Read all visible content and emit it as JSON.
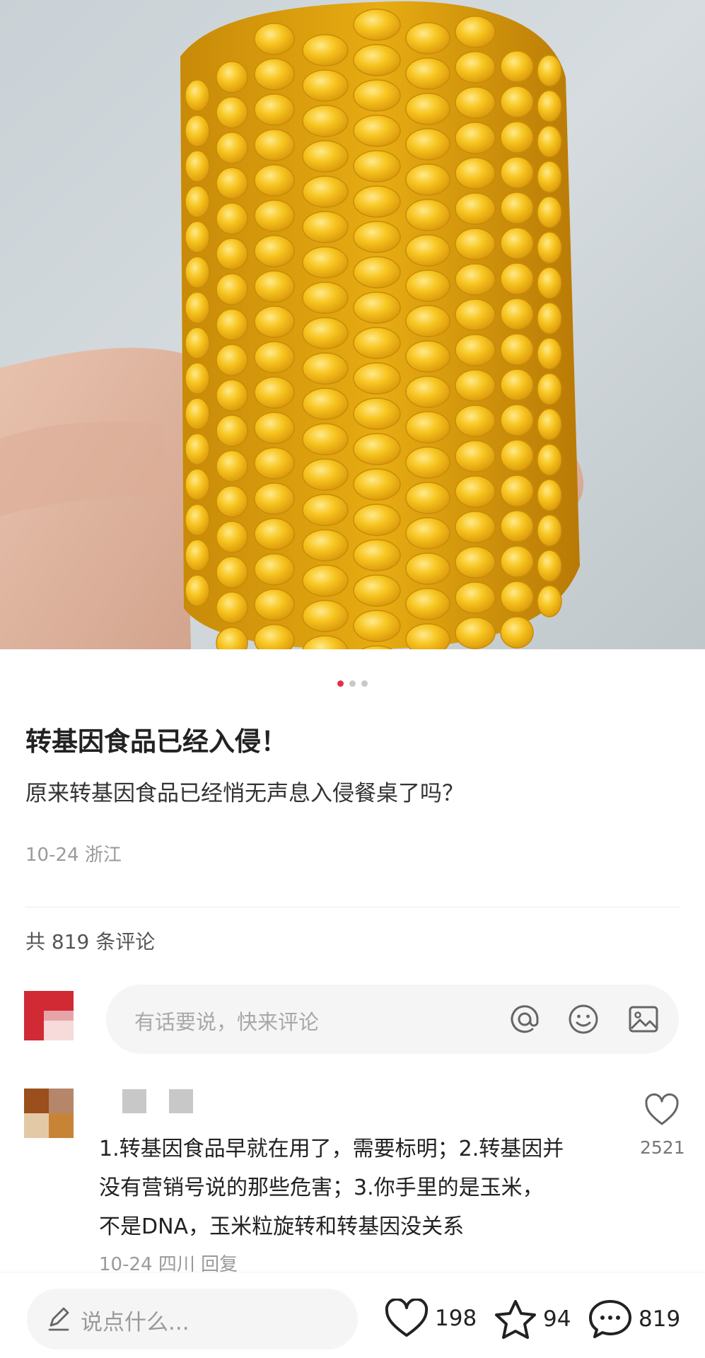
{
  "post": {
    "title": "转基因食品已经入侵！",
    "body": "原来转基因食品已经悄无声息入侵餐桌了吗？",
    "date": "10-24",
    "location": "浙江",
    "carousel": {
      "total": 3,
      "active": 1
    }
  },
  "comments_header": {
    "count_text": "共 819 条评论"
  },
  "comment_input": {
    "placeholder": "有话要说，快来评论",
    "icons": [
      "at-icon",
      "emoji-icon",
      "image-icon"
    ]
  },
  "comments": [
    {
      "text_lines": [
        "1.转基因食品早就在用了，需要标明；2.转基因并",
        "没有营销号说的那些危害；3.你手里的是玉米，",
        "不是DNA，玉米粒旋转和转基因没关系"
      ],
      "date": "10-24",
      "location": "四川",
      "reply_label": "回复",
      "likes": "2521"
    }
  ],
  "bottom_bar": {
    "say_placeholder": "说点什么...",
    "like_count": "198",
    "fav_count": "94",
    "comment_count": "819"
  },
  "colors": {
    "accent": "#e3314a",
    "muted": "#9a9a9a",
    "input_bg": "#f5f5f5"
  }
}
